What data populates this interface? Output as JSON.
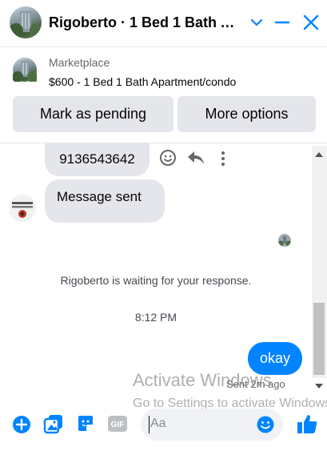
{
  "header": {
    "title": "Rigoberto · 1 Bed 1 Bath A…",
    "icons": [
      "avatar",
      "chevron-down-icon",
      "minimize-icon",
      "close-icon"
    ]
  },
  "marketplace": {
    "label": "Marketplace",
    "listing": "$600 - 1 Bed 1 Bath Apartment/condo",
    "buttons": {
      "pending": "Mark as pending",
      "more": "More options"
    }
  },
  "messages": {
    "phone": "9136543642",
    "sent_text": "Message sent",
    "waiting": "Rigoberto is waiting for your response.",
    "timestamp": "8:12 PM",
    "outgoing": "okay",
    "status": "Sent 2m ago"
  },
  "watermark": {
    "line1": "Activate Windows",
    "line2": "Go to Settings to activate Windows."
  },
  "composer": {
    "placeholder": "Aa"
  },
  "colors": {
    "accent": "#0084ff",
    "bubble_gray": "#e4e6eb"
  }
}
